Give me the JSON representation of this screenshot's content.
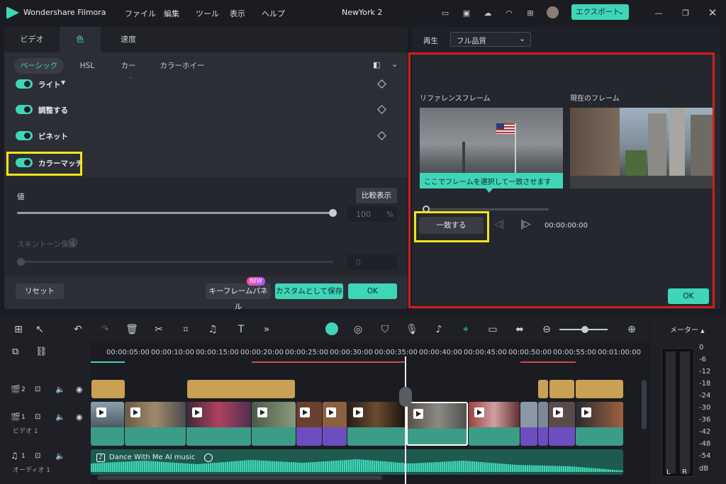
{
  "app": {
    "name": "Wondershare Filmora",
    "project": "NewYork 2"
  },
  "menu": [
    "ファイル",
    "編集",
    "ツール",
    "表示",
    "ヘルプ"
  ],
  "export_label": "エクスポート",
  "tabs": [
    "ビデオ",
    "色",
    "速度"
  ],
  "subtabs": [
    "ベーシック",
    "HSL",
    "カーブ",
    "カラーホイール"
  ],
  "rows": [
    "ライト",
    "調整する",
    "ビネット",
    "カラーマッチ"
  ],
  "value": {
    "label": "値",
    "compare": "比較表示",
    "number": "100",
    "unit": "%",
    "slider_fraction": 1.0
  },
  "skin": {
    "label": "スキントーン保護",
    "number": "0"
  },
  "bottom_buttons": {
    "reset": "リセット",
    "keyframe": "キーフレームパネル",
    "new_badge": "NEW",
    "save_custom": "カスタムとして保存",
    "ok": "OK"
  },
  "preview": {
    "label": "再生",
    "quality": "フル品質",
    "ref_frame": "リファレンスフレーム",
    "cur_frame": "現在のフレーム",
    "tooltip": "ここでフレームを選択して一致させます",
    "match_button": "一致する",
    "timecode": "00:00:00:00",
    "ok": "OK"
  },
  "ruler": [
    "00:00:05:00",
    "00:00:10:00",
    "00:00:15:00",
    "00:00:20:00",
    "00:00:25:00",
    "00:00:30:00",
    "00:00:35:00",
    "00:00:40:00",
    "00:00:45:00",
    "00:00:50:00",
    "00:00:55:00",
    "00:01:00:00"
  ],
  "tracks": {
    "video_label": "ビデオ 1",
    "audio_label": "オーディオ 1",
    "audio_clip": "Dance With Me AI music",
    "t2": "2",
    "t1": "1",
    "a1": "1"
  },
  "meter": {
    "title": "メーター",
    "db": [
      "0",
      "-6",
      "-12",
      "-18",
      "-24",
      "-30",
      "-36",
      "-42",
      "-48",
      "-54",
      "dB"
    ],
    "left": "L",
    "right": "R"
  },
  "colors": {
    "accent": "#3fd6b8",
    "highlight_red": "#d21d1d",
    "highlight_yellow": "#f2e51c"
  }
}
